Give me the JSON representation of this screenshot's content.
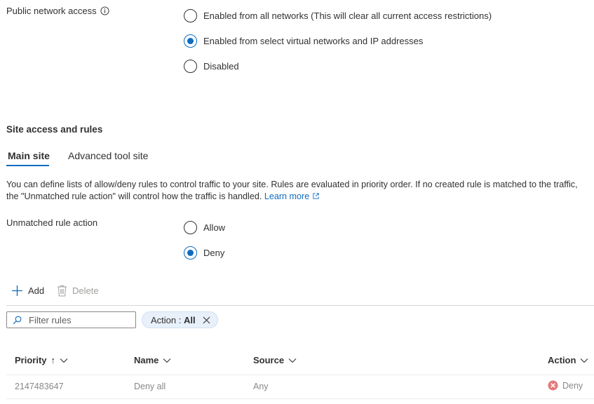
{
  "public_access": {
    "label": "Public network access",
    "options": [
      {
        "label": "Enabled from all networks (This will clear all current access restrictions)",
        "checked": false
      },
      {
        "label": "Enabled from select virtual networks and IP addresses",
        "checked": true
      },
      {
        "label": "Disabled",
        "checked": false
      }
    ]
  },
  "site_access": {
    "title": "Site access and rules",
    "tabs": [
      {
        "label": "Main site",
        "active": true
      },
      {
        "label": "Advanced tool site",
        "active": false
      }
    ],
    "description": "You can define lists of allow/deny rules to control traffic to your site. Rules are evaluated in priority order. If no created rule is matched to the traffic, the \"Unmatched rule action\" will control how the traffic is handled.",
    "learn_more": "Learn more"
  },
  "unmatched": {
    "label": "Unmatched rule action",
    "options": [
      {
        "label": "Allow",
        "checked": false
      },
      {
        "label": "Deny",
        "checked": true
      }
    ]
  },
  "toolbar": {
    "add_label": "Add",
    "delete_label": "Delete"
  },
  "filter": {
    "placeholder": "Filter rules",
    "pill_key": "Action : ",
    "pill_value": "All"
  },
  "table": {
    "columns": {
      "priority": "Priority",
      "priority_sort": "↑",
      "name": "Name",
      "source": "Source",
      "action": "Action"
    },
    "rows": [
      {
        "priority": "2147483647",
        "name": "Deny all",
        "source": "Any",
        "action": "Deny"
      }
    ]
  },
  "colors": {
    "accent": "#0f6cbd",
    "deny": "#d13438",
    "disabled_text": "#a19f9d"
  }
}
